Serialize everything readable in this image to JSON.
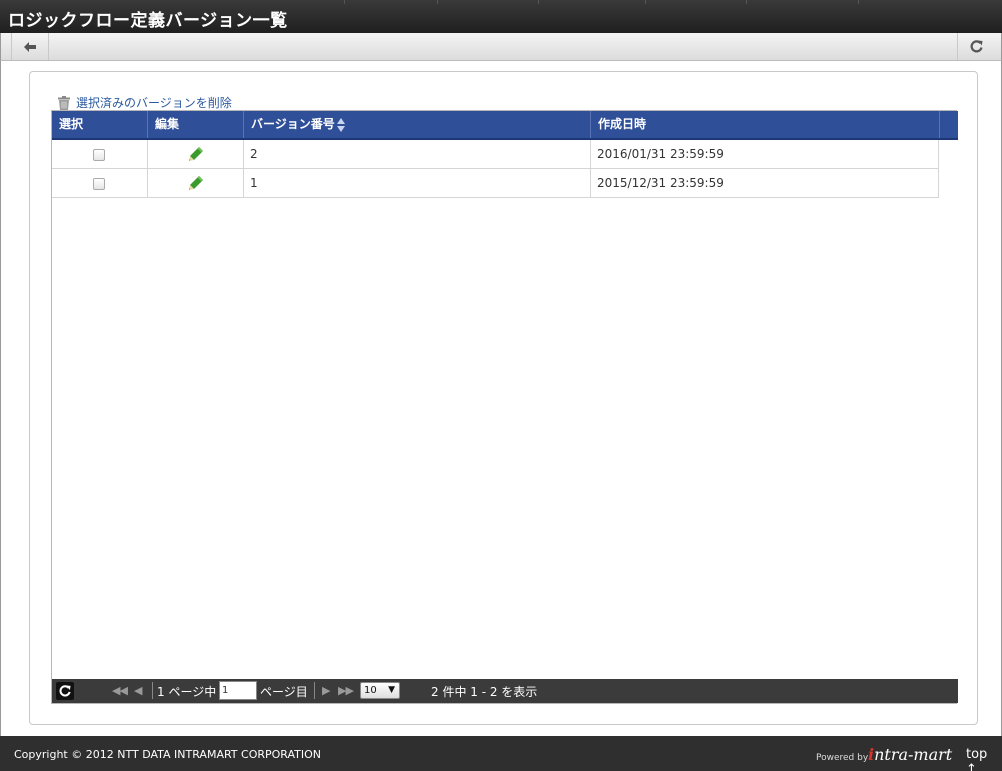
{
  "header": {
    "title": "ロジックフロー定義バージョン一覧"
  },
  "toolbar": {
    "back_icon": "arrow-left-icon",
    "reload_icon": "refresh-icon"
  },
  "actions": {
    "delete_selected_label": "選択済みのバージョンを削除",
    "delete_icon": "trash-icon"
  },
  "table": {
    "columns": [
      "選択",
      "編集",
      "バージョン番号",
      "作成日時"
    ],
    "rows": [
      {
        "version": "2",
        "created": "2016/01/31 23:59:59",
        "selected": false
      },
      {
        "version": "1",
        "created": "2015/12/31 23:59:59",
        "selected": false
      }
    ],
    "header_color": "#2f4f98",
    "edit_icon_color": "#3a9a2a"
  },
  "pager": {
    "current_page_prefix": "1 ページ中",
    "current_page_value": "1",
    "current_page_suffix": "ページ目",
    "page_size": "10",
    "summary": "2 件中 1 - 2 を表示"
  },
  "footer": {
    "copyright": "Copyright © 2012 NTT DATA INTRAMART CORPORATION",
    "powered_by": "Powered by",
    "brand_prefix": "i",
    "brand_rest": "ntra-mart",
    "top_link": "top ↑"
  }
}
